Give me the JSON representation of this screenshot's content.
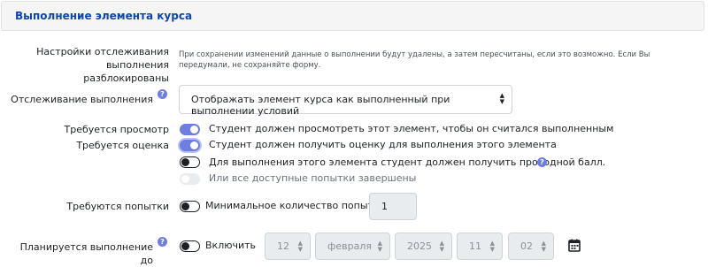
{
  "header": {
    "title": "Выполнение элемента курса"
  },
  "unlock": {
    "label_line1": "Настройки отслеживания выполнения",
    "label_line2": "разблокированы",
    "note": "При сохранении изменений данные о выполнении будут удалены, а затем пересчитаны, если это возможно. Если Вы передумали, не сохраняйте форму."
  },
  "tracking": {
    "label": "Отслеживание выполнения",
    "help_icon": "question-circle-icon",
    "selected": "Отображать элемент курса как выполненный при выполнении условий"
  },
  "require_view": {
    "label": "Требуется просмотр",
    "checked": true,
    "text": "Студент должен просмотреть этот элемент, чтобы он считался выполненным"
  },
  "require_grade": {
    "label": "Требуется оценка",
    "checked": true,
    "text": "Студент должен получить оценку для выполнения этого элемента"
  },
  "pass_grade": {
    "checked": false,
    "text": "Для выполнения этого элемента студент должен получить проходной балл.",
    "help_icon": "question-circle-icon"
  },
  "all_attempts": {
    "checked": false,
    "disabled": true,
    "text": "Или все доступные попытки завершены"
  },
  "attempts": {
    "label": "Требуются попытки",
    "checked": false,
    "text": "Минимальное количество попыток:",
    "value": "1"
  },
  "expected": {
    "label": "Планируется выполнение до",
    "help_icon": "question-circle-icon",
    "checked": false,
    "enable_text": "Включить",
    "day": "12",
    "month": "февраля",
    "year": "2025",
    "hour": "11",
    "minute": "02",
    "calendar_icon": "calendar-icon"
  },
  "colors": {
    "accent": "#6e7ee0",
    "header_title": "#0f47ad",
    "disabled_field": "#e9ecef"
  }
}
